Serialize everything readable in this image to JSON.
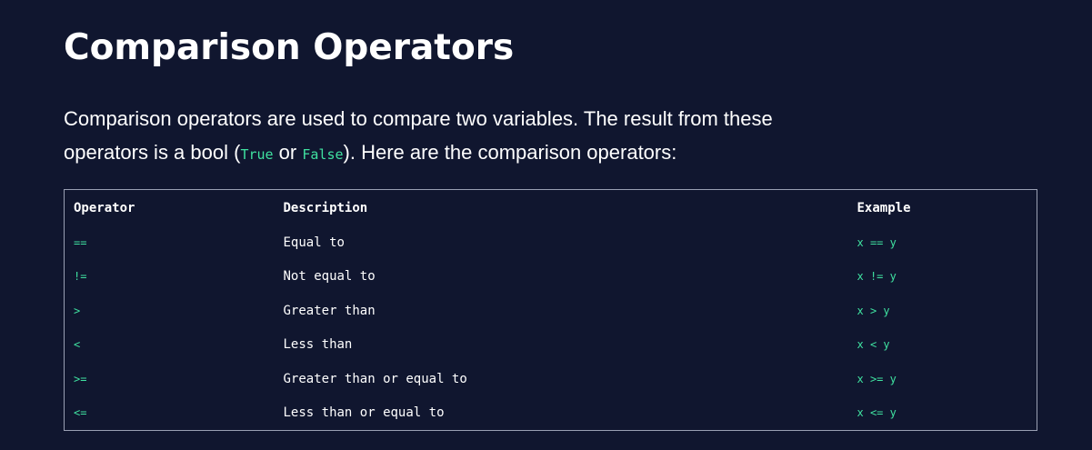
{
  "heading": "Comparison Operators",
  "intro": {
    "part1": "Comparison operators are used to compare two variables. The result from these operators is a bool (",
    "true_code": "True",
    "or_text": " or ",
    "false_code": "False",
    "part2": "). Here are the comparison operators:"
  },
  "table": {
    "headers": [
      "Operator",
      "Description",
      "Example"
    ],
    "rows": [
      {
        "operator": "==",
        "description": "Equal to",
        "example": "x == y"
      },
      {
        "operator": "!=",
        "description": "Not equal to",
        "example": "x != y"
      },
      {
        "operator": ">",
        "description": "Greater than",
        "example": "x > y"
      },
      {
        "operator": "<",
        "description": "Less than",
        "example": "x < y"
      },
      {
        "operator": ">=",
        "description": "Greater than or equal to",
        "example": "x >= y"
      },
      {
        "operator": "<=",
        "description": "Less than or equal to",
        "example": "x <= y"
      }
    ]
  },
  "colors": {
    "background": "#10162f",
    "text": "#ffffff",
    "code_accent": "#3fe1a0",
    "table_border": "#9aa0b3"
  }
}
